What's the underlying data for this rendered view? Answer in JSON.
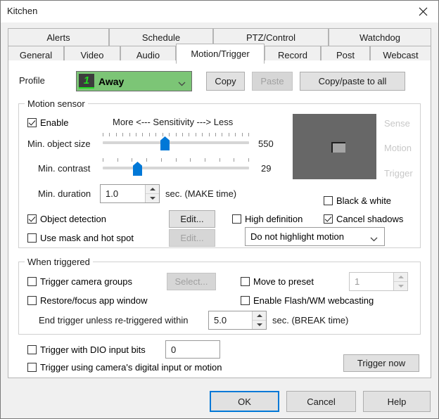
{
  "window": {
    "title": "Kitchen",
    "close_icon": "close-icon"
  },
  "tabs": {
    "row1": [
      {
        "label": "Alerts",
        "active": false
      },
      {
        "label": "Schedule",
        "active": false
      },
      {
        "label": "PTZ/Control",
        "active": false
      },
      {
        "label": "Watchdog",
        "active": false
      }
    ],
    "row2": [
      {
        "label": "General",
        "active": false
      },
      {
        "label": "Video",
        "active": false
      },
      {
        "label": "Audio",
        "active": false
      },
      {
        "label": "Motion/Trigger",
        "active": true
      },
      {
        "label": "Record",
        "active": false
      },
      {
        "label": "Post",
        "active": false
      },
      {
        "label": "Webcast",
        "active": false
      }
    ]
  },
  "profile": {
    "label": "Profile",
    "value": "Away",
    "badge": "1",
    "color": "#7cc576",
    "copy_label": "Copy",
    "paste_label": "Paste",
    "paste_enabled": false,
    "copy_all_label": "Copy/paste to all"
  },
  "motion_sensor": {
    "legend": "Motion sensor",
    "enable": {
      "label": "Enable",
      "checked": true
    },
    "sensitivity_caption": "More <--- Sensitivity ---> Less",
    "min_object_size": {
      "label": "Min. object size",
      "value": "550",
      "position_pct": 42,
      "ticks": 23
    },
    "min_contrast": {
      "label": "Min. contrast",
      "value": "29",
      "position_pct": 22,
      "ticks": 11
    },
    "min_duration": {
      "label": "Min. duration",
      "value": "1.0",
      "suffix": "sec.  (MAKE time)"
    },
    "object_detection": {
      "label": "Object detection",
      "checked": true
    },
    "object_detection_edit": {
      "label": "Edit...",
      "enabled": true
    },
    "use_mask": {
      "label": "Use mask and hot spot",
      "checked": false
    },
    "use_mask_edit": {
      "label": "Edit...",
      "enabled": false
    },
    "high_definition": {
      "label": "High definition",
      "checked": false
    },
    "black_and_white": {
      "label": "Black & white",
      "checked": false
    },
    "cancel_shadows": {
      "label": "Cancel shadows",
      "checked": true
    },
    "highlight_combo": {
      "value": "Do not highlight motion"
    },
    "preview_labels": [
      "Sense",
      "Motion",
      "Trigger"
    ]
  },
  "when_triggered": {
    "legend": "When triggered",
    "trigger_camera_groups": {
      "label": "Trigger camera groups",
      "checked": false
    },
    "select_button": {
      "label": "Select...",
      "enabled": false
    },
    "move_to_preset": {
      "label": "Move to preset",
      "checked": false
    },
    "preset_value": "1",
    "restore_focus": {
      "label": "Restore/focus app window",
      "checked": false
    },
    "enable_flash": {
      "label": "Enable Flash/WM webcasting",
      "checked": false
    },
    "end_trigger_label": "End trigger unless re-triggered within",
    "end_trigger_value": "5.0",
    "end_trigger_suffix": "sec.  (BREAK time)"
  },
  "bottom": {
    "dio": {
      "label": "Trigger with DIO input bits",
      "checked": false,
      "value": "0"
    },
    "camera_digital": {
      "label": "Trigger using camera's digital input or motion",
      "checked": false
    },
    "trigger_now_label": "Trigger now"
  },
  "footer": {
    "ok_label": "OK",
    "cancel_label": "Cancel",
    "help_label": "Help"
  }
}
